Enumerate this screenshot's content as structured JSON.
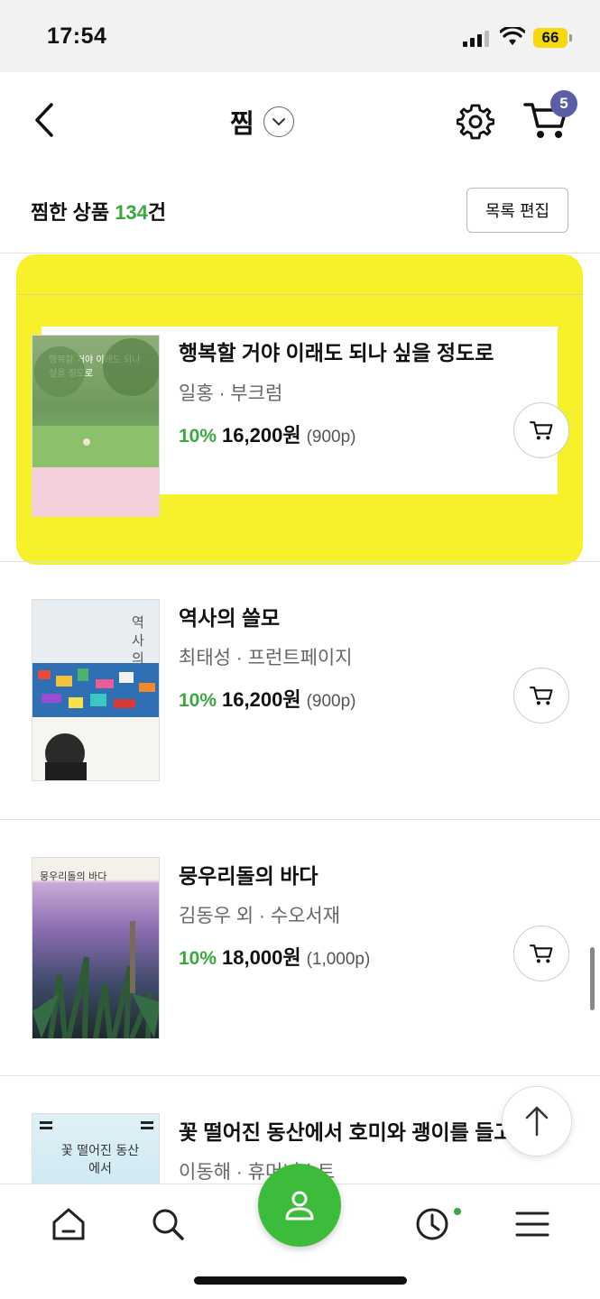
{
  "status_bar": {
    "time": "17:54",
    "battery": "66"
  },
  "header": {
    "title": "찜",
    "cart_count": "5"
  },
  "summary": {
    "prefix": "찜한 상품 ",
    "count": "134",
    "suffix": "건",
    "edit_label": "목록 편집"
  },
  "items": [
    {
      "title": "행복할 거야 이래도 되나 싶을 정도로",
      "author_publisher": "일홍 · 부크럼",
      "discount": "10%",
      "price": "16,200원",
      "points": "(900p)",
      "cover_text": "행복할 거야 이래도 되나 싶을 정도로"
    },
    {
      "title": "역사의 쓸모",
      "author_publisher": "최태성 · 프런트페이지",
      "discount": "10%",
      "price": "16,200원",
      "points": "(900p)",
      "cover_text": "역사의 쓸모"
    },
    {
      "title": "뭉우리돌의 바다",
      "author_publisher": "김동우 외 · 수오서재",
      "discount": "10%",
      "price": "18,000원",
      "points": "(1,000p)",
      "cover_text": "뭉우리돌의 바다"
    },
    {
      "title": "꽃 떨어진 동산에서 호미와 괭이를 들고",
      "author_publisher": "이동해 · 휴머니스트",
      "cover_text": "꽃 떨어진 동산에서"
    }
  ],
  "colors": {
    "accent_green": "#3aa83e",
    "badge": "#5b5ea6",
    "highlight": "#f5f018"
  },
  "icons": [
    "back-icon",
    "chevron-down-icon",
    "gear-icon",
    "cart-icon",
    "home-icon",
    "search-icon",
    "user-icon",
    "clock-icon",
    "menu-icon",
    "arrow-up-icon"
  ]
}
